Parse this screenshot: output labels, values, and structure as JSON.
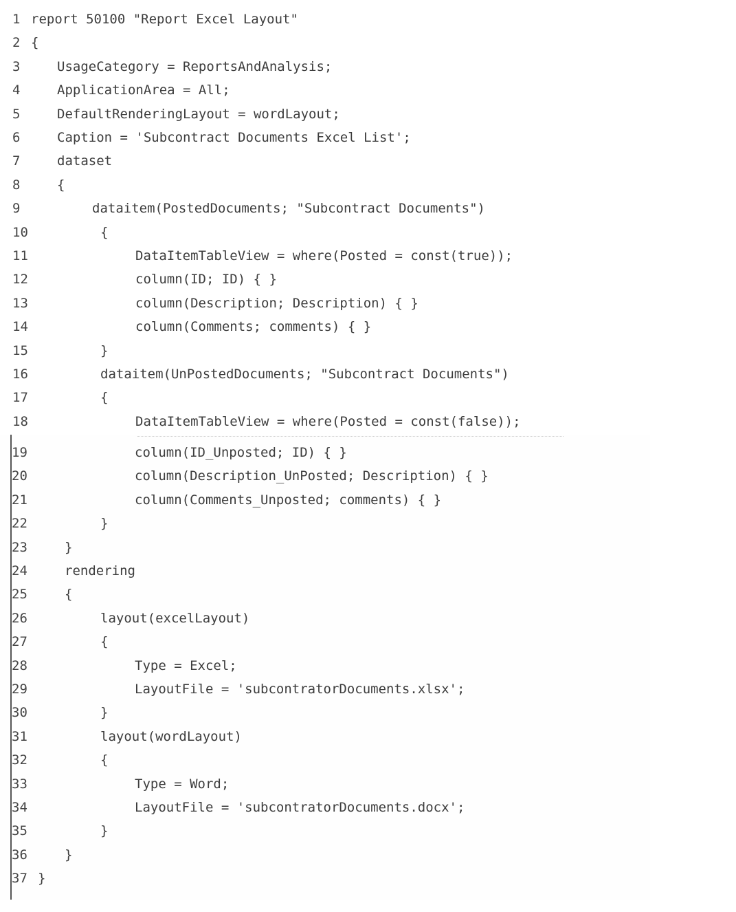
{
  "document": {
    "type": "code-listing",
    "language": "AL",
    "lines": [
      {
        "n": "1",
        "indent": 0,
        "text": "report 50100 \"Report Excel Layout\""
      },
      {
        "n": "2",
        "indent": 0,
        "text": "{"
      },
      {
        "n": "3",
        "indent": 1,
        "text": "UsageCategory = ReportsAndAnalysis;"
      },
      {
        "n": "4",
        "indent": 1,
        "text": "ApplicationArea = All;"
      },
      {
        "n": "5",
        "indent": 1,
        "text": "DefaultRenderingLayout = wordLayout;"
      },
      {
        "n": "6",
        "indent": 1,
        "text": "Caption = 'Subcontract Documents Excel List';"
      },
      {
        "n": "7",
        "indent": 1,
        "text": "dataset"
      },
      {
        "n": "8",
        "indent": 1,
        "text": "{"
      },
      {
        "n": "9",
        "indent": 2,
        "text": "dataitem(PostedDocuments; \"Subcontract Documents\")"
      },
      {
        "n": "10",
        "indent": 2,
        "text": "{"
      },
      {
        "n": "11",
        "indent": 3,
        "text": "DataItemTableView = where(Posted = const(true));"
      },
      {
        "n": "12",
        "indent": 3,
        "text": "column(ID; ID) { }"
      },
      {
        "n": "13",
        "indent": 3,
        "text": "column(Description; Description) { }"
      },
      {
        "n": "14",
        "indent": 3,
        "text": "column(Comments; comments) { }"
      },
      {
        "n": "15",
        "indent": 2,
        "text": "}"
      },
      {
        "n": "16",
        "indent": 2,
        "text": "dataitem(UnPostedDocuments; \"Subcontract Documents\")"
      },
      {
        "n": "17",
        "indent": 2,
        "text": "{"
      },
      {
        "n": "18",
        "indent": 3,
        "text": "DataItemTableView = where(Posted = const(false));"
      },
      {
        "n": "19",
        "indent": 3,
        "text": "column(ID_Unposted; ID) { }"
      },
      {
        "n": "20",
        "indent": 3,
        "text": "column(Description_UnPosted; Description) { }"
      },
      {
        "n": "21",
        "indent": 3,
        "text": "column(Comments_Unposted; comments) { }"
      },
      {
        "n": "22",
        "indent": 2,
        "text": "}"
      },
      {
        "n": "23",
        "indent": 1,
        "text": "}"
      },
      {
        "n": "24",
        "indent": 1,
        "text": "rendering"
      },
      {
        "n": "25",
        "indent": 1,
        "text": "{"
      },
      {
        "n": "26",
        "indent": 2,
        "text": "layout(excelLayout)"
      },
      {
        "n": "27",
        "indent": 2,
        "text": "{"
      },
      {
        "n": "28",
        "indent": 3,
        "text": "Type = Excel;"
      },
      {
        "n": "29",
        "indent": 3,
        "text": "LayoutFile = 'subcontratorDocuments.xlsx';"
      },
      {
        "n": "30",
        "indent": 2,
        "text": "}"
      },
      {
        "n": "31",
        "indent": 2,
        "text": "layout(wordLayout)"
      },
      {
        "n": "32",
        "indent": 2,
        "text": "{"
      },
      {
        "n": "33",
        "indent": 3,
        "text": "Type = Word;"
      },
      {
        "n": "34",
        "indent": 3,
        "text": "LayoutFile = 'subcontratorDocuments.docx';"
      },
      {
        "n": "35",
        "indent": 2,
        "text": "}"
      },
      {
        "n": "36",
        "indent": 1,
        "text": "}"
      },
      {
        "n": "37",
        "indent": 0,
        "text": "}"
      }
    ]
  }
}
